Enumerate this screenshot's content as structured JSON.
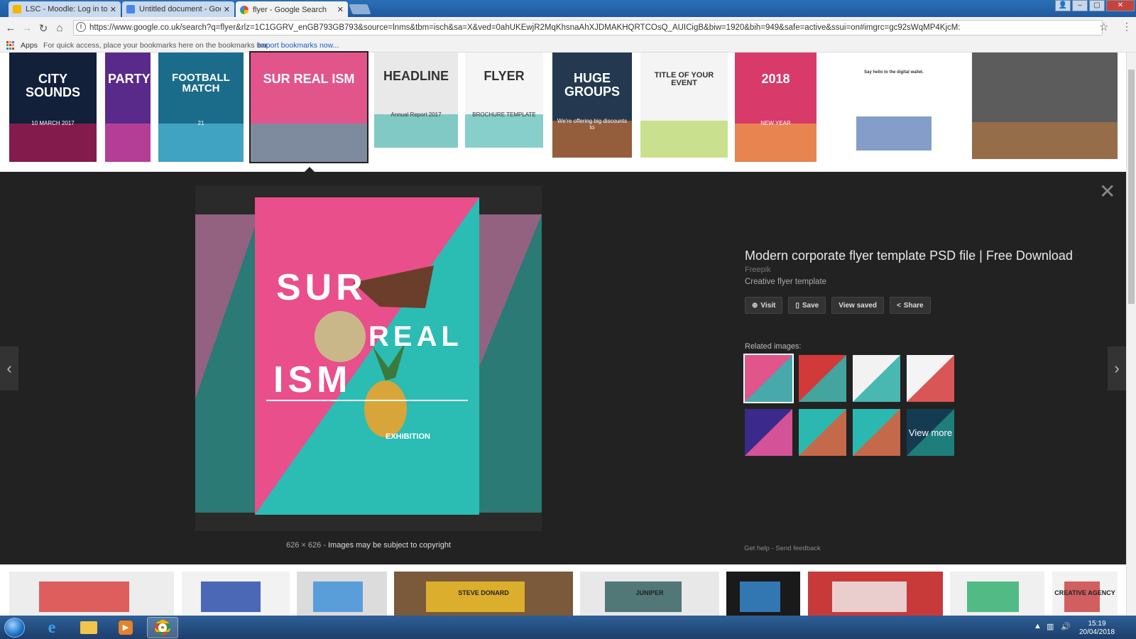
{
  "browser": {
    "tabs": [
      {
        "title": "LSC - Moodle: Log in to t",
        "favicon": "moodle-icon",
        "color": "#f7b500"
      },
      {
        "title": "Untitled document - Goo",
        "favicon": "google-docs-icon",
        "color": "#4a86e8"
      },
      {
        "title": "flyer - Google Search",
        "favicon": "google-icon",
        "color": "#ffffff"
      }
    ],
    "url": "https://www.google.co.uk/search?q=flyer&rlz=1C1GGRV_enGB793GB793&source=lnms&tbm=isch&sa=X&ved=0ahUKEwjR2MqKhsnaAhXJDMAKHQRTCOsQ_AUICigB&biw=1920&bih=949&safe=active&ssui=on#imgrc=gc92sWqMP4KjcM:",
    "bookmarks": {
      "apps_label": "Apps",
      "hint": "For quick access, place your bookmarks here on the bookmarks bar.",
      "import_link": "Import bookmarks now..."
    }
  },
  "top_thumbnails": [
    {
      "text": "CITY SOUNDS",
      "sub": "10 MARCH 2017",
      "bg": "#12203a",
      "accent": "#e0195b"
    },
    {
      "text": "PARTY",
      "sub": "",
      "bg": "#5a2a8a",
      "accent": "#ff4fa0"
    },
    {
      "text": "FOOTBALL MATCH",
      "sub": "21",
      "bg": "#1b6c8a",
      "accent": "#5fd2f0"
    },
    {
      "text": "SUR REAL ISM",
      "sub": "",
      "bg": "#e2558a",
      "accent": "#2bb8b0"
    },
    {
      "text": "HEADLINE",
      "sub": "Annual Report 2017",
      "bg": "#e9e9e9",
      "accent": "#2aaea6"
    },
    {
      "text": "FLYER",
      "sub": "BROCHURE TEMPLATE",
      "bg": "#f5f5f5",
      "accent": "#2aaea6"
    },
    {
      "text": "HUGE GROUPS",
      "sub": "We're offering big discounts to",
      "bg": "#243850",
      "accent": "#f07d2e"
    },
    {
      "text": "TITLE OF YOUR EVENT",
      "sub": "",
      "bg": "#f4f4f4",
      "accent": "#a6d23a"
    },
    {
      "text": "2018",
      "sub": "NEW YEAR",
      "bg": "#d83a6a",
      "accent": "#f5c13a"
    },
    {
      "text": "Say hello to the digital wallet.",
      "sub": "",
      "bg": "#ffffff",
      "accent": "#1f4f9c"
    },
    {
      "text": "",
      "sub": "",
      "bg": "#5c5c5c",
      "accent": "#c77b3a"
    }
  ],
  "detail": {
    "preview": {
      "word1": "SUR",
      "word2": "REAL",
      "word3": "ISM",
      "exhibition": "EXHIBITION",
      "pink": "#e94f8a",
      "teal": "#2bbcb3"
    },
    "dimensions": "626 × 626",
    "copyright": "Images may be subject to copyright",
    "title": "Modern corporate flyer template PSD file | Free Download",
    "source": "Freepik",
    "description": "Creative flyer template",
    "actions": [
      {
        "label": "Visit",
        "icon": "globe-icon",
        "glyph": "⊕"
      },
      {
        "label": "Save",
        "icon": "bookmark-icon",
        "glyph": "▯"
      },
      {
        "label": "View saved",
        "icon": "",
        "glyph": ""
      },
      {
        "label": "Share",
        "icon": "share-icon",
        "glyph": "<"
      }
    ],
    "related_label": "Related images:",
    "related": [
      {
        "bg": "#e2558a",
        "accent": "#2bb8b0"
      },
      {
        "bg": "#d23a3a",
        "accent": "#2bb8b0"
      },
      {
        "bg": "#f2f2f2",
        "accent": "#2aaea6"
      },
      {
        "bg": "#f4f4f4",
        "accent": "#d43a3a"
      },
      {
        "bg": "#3b2a8a",
        "accent": "#f05a9a"
      },
      {
        "bg": "#2bb8b0",
        "accent": "#e05a3a"
      },
      {
        "bg": "#2bb8b0",
        "accent": "#e05a3a"
      },
      {
        "bg": "#1d4f6f",
        "accent": "#2bb8b0"
      }
    ],
    "view_more": "View more",
    "help": "Get help",
    "feedback": "Send feedback"
  },
  "bottom_thumbnails": [
    {
      "bg": "#ededed",
      "accent": "#d93a3a"
    },
    {
      "bg": "#f2f2f2",
      "accent": "#2145a8"
    },
    {
      "bg": "#dcdcdc",
      "accent": "#3a8ed8"
    },
    {
      "bg": "#7a5a3a",
      "accent": "#f5c32a",
      "text": "STEVE DONARD"
    },
    {
      "bg": "#e8e8e8",
      "accent": "#2a5a5a",
      "text": "JUNIPER"
    },
    {
      "bg": "#1a1a1a",
      "accent": "#3a8ed8"
    },
    {
      "bg": "#c83a3a",
      "accent": "#f2f2f2"
    },
    {
      "bg": "#f0f0f0",
      "accent": "#2aae6a"
    },
    {
      "bg": "#f2f2f2",
      "accent": "#c83a3a",
      "text": "CREATIVE AGENCY"
    }
  ],
  "taskbar": {
    "time": "15:19",
    "date": "20/04/2018"
  }
}
